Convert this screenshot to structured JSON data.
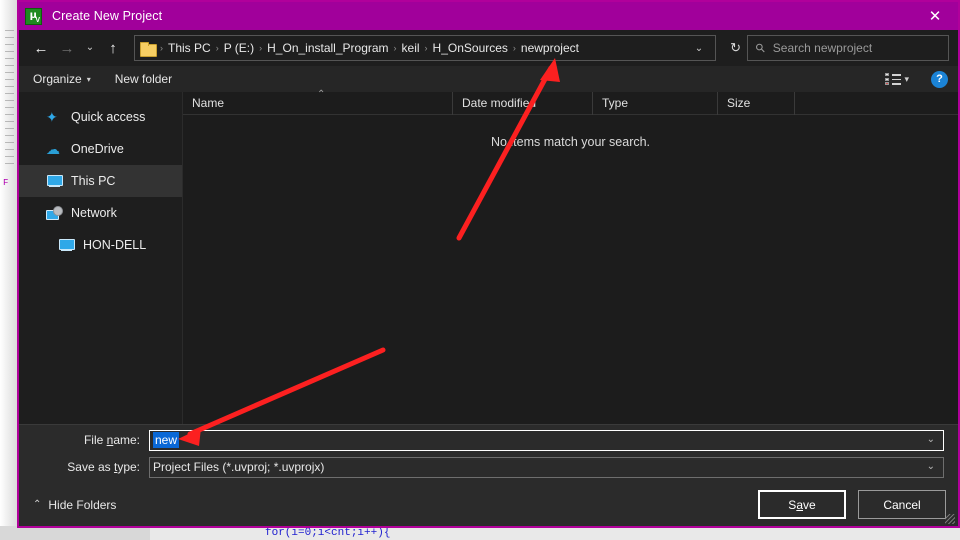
{
  "window": {
    "title": "Create New Project",
    "app_icon": "keil-uvision-icon",
    "close_label": "✕",
    "titlebar_color": "#a1009b"
  },
  "nav": {
    "back": "←",
    "forward": "→",
    "recent_chevron": "⌄",
    "up": "↑",
    "refresh": "↻",
    "address_chevron": "⌄",
    "breadcrumbs": [
      "This PC",
      "P (E:)",
      "H_On_install_Program",
      "keil",
      "H_OnSources",
      "newproject"
    ],
    "separator": "›"
  },
  "search": {
    "placeholder": "Search newproject",
    "icon": "search-icon"
  },
  "toolbar": {
    "organize": "Organize",
    "organize_chevron": "▾",
    "new_folder": "New folder",
    "view_chevron": "▾",
    "help": "?"
  },
  "sidebar": {
    "items": [
      {
        "label": "Quick access",
        "icon": "star-icon",
        "selected": false,
        "indent": false
      },
      {
        "label": "OneDrive",
        "icon": "cloud-icon",
        "selected": false,
        "indent": false
      },
      {
        "label": "This PC",
        "icon": "computer-icon",
        "selected": true,
        "indent": false
      },
      {
        "label": "Network",
        "icon": "network-icon",
        "selected": false,
        "indent": false
      },
      {
        "label": "HON-DELL",
        "icon": "computer-icon",
        "selected": false,
        "indent": true
      }
    ]
  },
  "filepane": {
    "columns": [
      "Name",
      "Date modified",
      "Type",
      "Size"
    ],
    "sort_indicator": "⌃",
    "empty_message": "No items match your search.",
    "rows": []
  },
  "form": {
    "file_name_label": "File name:",
    "file_name_label_pre": "File ",
    "file_name_label_mnemonic": "n",
    "file_name_label_post": "ame:",
    "file_name_value": "new",
    "save_as_type_label": "Save as type:",
    "save_as_type_label_pre": "Save as ",
    "save_as_type_label_mnemonic": "t",
    "save_as_type_label_post": "ype:",
    "save_as_type_value": "Project Files (*.uvproj; *.uvprojx)",
    "combo_chevron": "⌄",
    "selection_color": "#0a68d6"
  },
  "footer": {
    "hide_folders": "Hide Folders",
    "hide_folders_chevron": "⌃",
    "save_pre": "S",
    "save_mnemonic": "a",
    "save_post": "ve",
    "save_label": "Save",
    "cancel_label": "Cancel"
  },
  "annotations": {
    "color": "#fc2020",
    "arrow1_target": "newproject-breadcrumb",
    "arrow2_target": "file-name-input"
  },
  "background": {
    "code_snippet": "for(i=0;i<cnt;i++){"
  }
}
